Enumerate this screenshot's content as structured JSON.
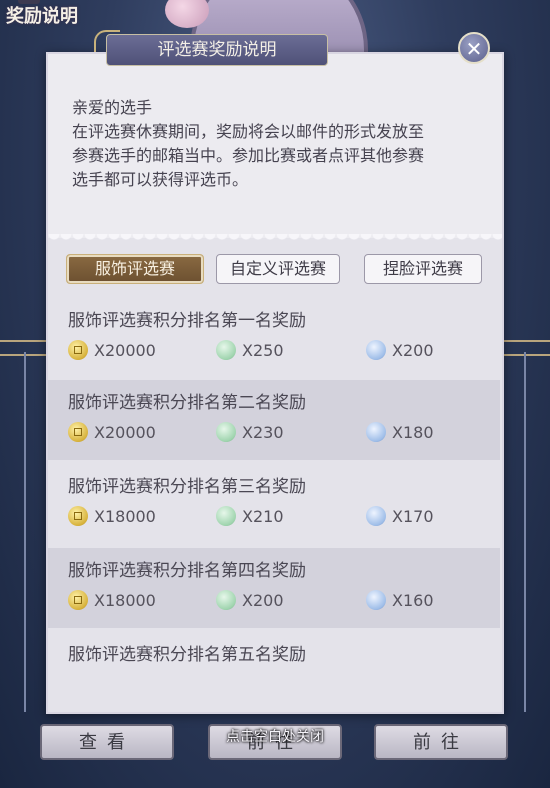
{
  "background": {
    "top_left_label": "奖励说明"
  },
  "dialog": {
    "title": "评选赛奖励说明",
    "close_symbol": "✕",
    "intro": {
      "greeting": "亲爱的选手",
      "line1": "在评选赛休赛期间，奖励将会以邮件的形式发放至",
      "line2": "参赛选手的邮箱当中。参加比赛或者点评其他参赛",
      "line3": "选手都可以获得评选币。"
    },
    "tabs": [
      {
        "label": "服饰评选赛",
        "active": true
      },
      {
        "label": "自定义评选赛",
        "active": false
      },
      {
        "label": "捏脸评选赛",
        "active": false
      }
    ],
    "rewards": [
      {
        "title": "服饰评选赛积分排名第一名奖励",
        "gold": "X20000",
        "green": "X250",
        "blue": "X200"
      },
      {
        "title": "服饰评选赛积分排名第二名奖励",
        "gold": "X20000",
        "green": "X230",
        "blue": "X180"
      },
      {
        "title": "服饰评选赛积分排名第三名奖励",
        "gold": "X18000",
        "green": "X210",
        "blue": "X170"
      },
      {
        "title": "服饰评选赛积分排名第四名奖励",
        "gold": "X18000",
        "green": "X200",
        "blue": "X160"
      },
      {
        "title": "服饰评选赛积分排名第五名奖励"
      }
    ]
  },
  "bottom": {
    "view_label": "查看",
    "go_label_1": "前往",
    "go_label_2": "前往",
    "close_hint": "点击空白处关闭"
  },
  "colors": {
    "gold_coin": "#d7b23c",
    "green_coin": "#9fd4ae",
    "blue_coin": "#9ebde8",
    "active_tab": "#7a5c38"
  }
}
